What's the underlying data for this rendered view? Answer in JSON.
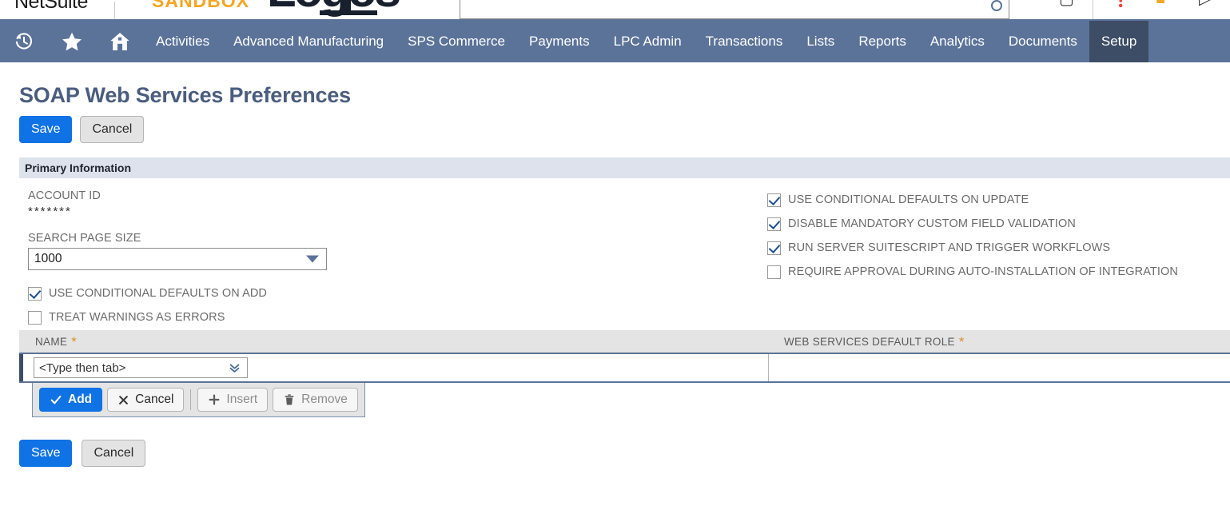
{
  "topbar": {
    "brand": "NetSuite",
    "environment": "SANDBOX",
    "logo_text": "Logos",
    "search_placeholder": "",
    "search_value": "",
    "icons": [
      {
        "name": "help-icon",
        "glyph": "?"
      },
      {
        "name": "feedback-icon",
        "glyph": "▷"
      }
    ]
  },
  "navbar": {
    "icons": [
      {
        "name": "recent-history-icon"
      },
      {
        "name": "favorites-star-icon"
      },
      {
        "name": "home-icon"
      }
    ],
    "items": [
      {
        "label": "Activities",
        "active": false
      },
      {
        "label": "Advanced Manufacturing",
        "active": false
      },
      {
        "label": "SPS Commerce",
        "active": false
      },
      {
        "label": "Payments",
        "active": false
      },
      {
        "label": "LPC Admin",
        "active": false
      },
      {
        "label": "Transactions",
        "active": false
      },
      {
        "label": "Lists",
        "active": false
      },
      {
        "label": "Reports",
        "active": false
      },
      {
        "label": "Analytics",
        "active": false
      },
      {
        "label": "Documents",
        "active": false
      },
      {
        "label": "Setup",
        "active": true
      }
    ]
  },
  "page": {
    "title": "SOAP Web Services Preferences",
    "save_label": "Save",
    "cancel_label": "Cancel"
  },
  "section": {
    "title": "Primary Information"
  },
  "fields": {
    "account_id": {
      "label": "ACCOUNT ID",
      "value": "*******"
    },
    "search_page_size": {
      "label": "SEARCH PAGE SIZE",
      "value": "1000"
    }
  },
  "checkboxes_left": [
    {
      "label": "USE CONDITIONAL DEFAULTS ON ADD",
      "checked": true
    },
    {
      "label": "TREAT WARNINGS AS ERRORS",
      "checked": false
    }
  ],
  "checkboxes_right": [
    {
      "label": "USE CONDITIONAL DEFAULTS ON UPDATE",
      "checked": true
    },
    {
      "label": "DISABLE MANDATORY CUSTOM FIELD VALIDATION",
      "checked": true
    },
    {
      "label": "RUN SERVER SUITESCRIPT AND TRIGGER WORKFLOWS",
      "checked": true
    },
    {
      "label": "REQUIRE APPROVAL DURING AUTO-INSTALLATION OF INTEGRATION",
      "checked": false
    }
  ],
  "sublist": {
    "columns": [
      {
        "label": "NAME",
        "required": true,
        "required_marker": "*"
      },
      {
        "label": "WEB SERVICES DEFAULT ROLE",
        "required": true,
        "required_marker": "*"
      }
    ],
    "row": {
      "name_value": "<Type then tab>",
      "role_value": ""
    },
    "toolbar": [
      {
        "label": "Add",
        "icon": "checkmark-icon",
        "style": "primary"
      },
      {
        "label": "Cancel",
        "icon": "x-icon",
        "style": "normal"
      },
      {
        "label": "Insert",
        "icon": "plus-icon",
        "style": "disabled"
      },
      {
        "label": "Remove",
        "icon": "trash-icon",
        "style": "disabled"
      }
    ]
  },
  "footer": {
    "save_label": "Save",
    "cancel_label": "Cancel"
  },
  "colors": {
    "nav_bg": "#5c7399",
    "nav_active_bg": "#3d4d66",
    "primary_button": "#0f72e5",
    "title_text": "#4a5d7e",
    "section_bg": "#dde2ec",
    "required_star": "#d89327",
    "sandbox_orange": "#f5a623"
  }
}
